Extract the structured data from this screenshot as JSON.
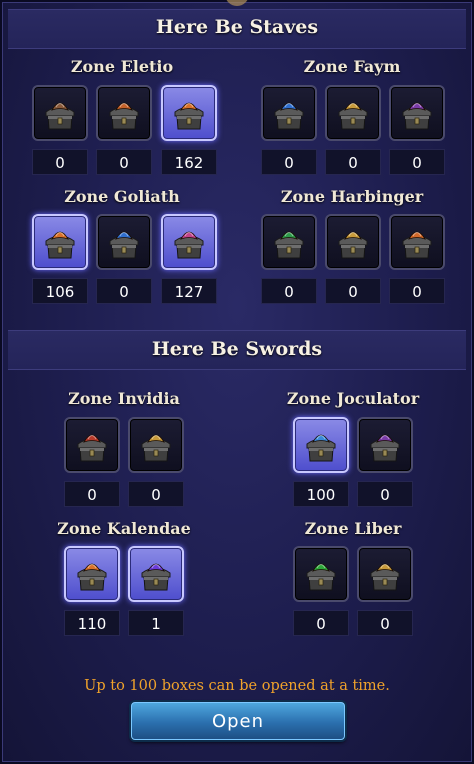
{
  "sections": [
    {
      "title": "Here Be Staves",
      "zones": [
        {
          "name": "Zone Eletio",
          "boxes": [
            {
              "color": "#8a5a3a",
              "count": "0",
              "active": false
            },
            {
              "color": "#c5622a",
              "count": "0",
              "active": false
            },
            {
              "color": "#d9722a",
              "count": "162",
              "active": true
            }
          ]
        },
        {
          "name": "Zone Faym",
          "boxes": [
            {
              "color": "#2f6fcf",
              "count": "0",
              "active": false
            },
            {
              "color": "#c89a3a",
              "count": "0",
              "active": false
            },
            {
              "color": "#7a3aa8",
              "count": "0",
              "active": false
            }
          ]
        },
        {
          "name": "Zone Goliath",
          "boxes": [
            {
              "color": "#d9722a",
              "count": "106",
              "active": true
            },
            {
              "color": "#2f6fcf",
              "count": "0",
              "active": false
            },
            {
              "color": "#c2448a",
              "count": "127",
              "active": true
            }
          ]
        },
        {
          "name": "Zone Harbinger",
          "boxes": [
            {
              "color": "#2e9a4a",
              "count": "0",
              "active": false
            },
            {
              "color": "#c89a3a",
              "count": "0",
              "active": false
            },
            {
              "color": "#d2692a",
              "count": "0",
              "active": false
            }
          ]
        }
      ]
    },
    {
      "title": "Here Be Swords",
      "zones": [
        {
          "name": "Zone Invidia",
          "boxes": [
            {
              "color": "#b83a2a",
              "count": "0",
              "active": false
            },
            {
              "color": "#c89a3a",
              "count": "0",
              "active": false
            }
          ]
        },
        {
          "name": "Zone Joculator",
          "boxes": [
            {
              "color": "#3a8ad9",
              "count": "100",
              "active": true
            },
            {
              "color": "#7a3aa8",
              "count": "0",
              "active": false
            }
          ]
        },
        {
          "name": "Zone Kalendae",
          "boxes": [
            {
              "color": "#d9722a",
              "count": "110",
              "active": true
            },
            {
              "color": "#6a3ad9",
              "count": "1",
              "active": true
            }
          ]
        },
        {
          "name": "Zone Liber",
          "boxes": [
            {
              "color": "#2ea83a",
              "count": "0",
              "active": false
            },
            {
              "color": "#c89a3a",
              "count": "0",
              "active": false
            }
          ]
        }
      ]
    }
  ],
  "notice": "Up to 100 boxes can be opened at a time.",
  "open_label": "Open"
}
